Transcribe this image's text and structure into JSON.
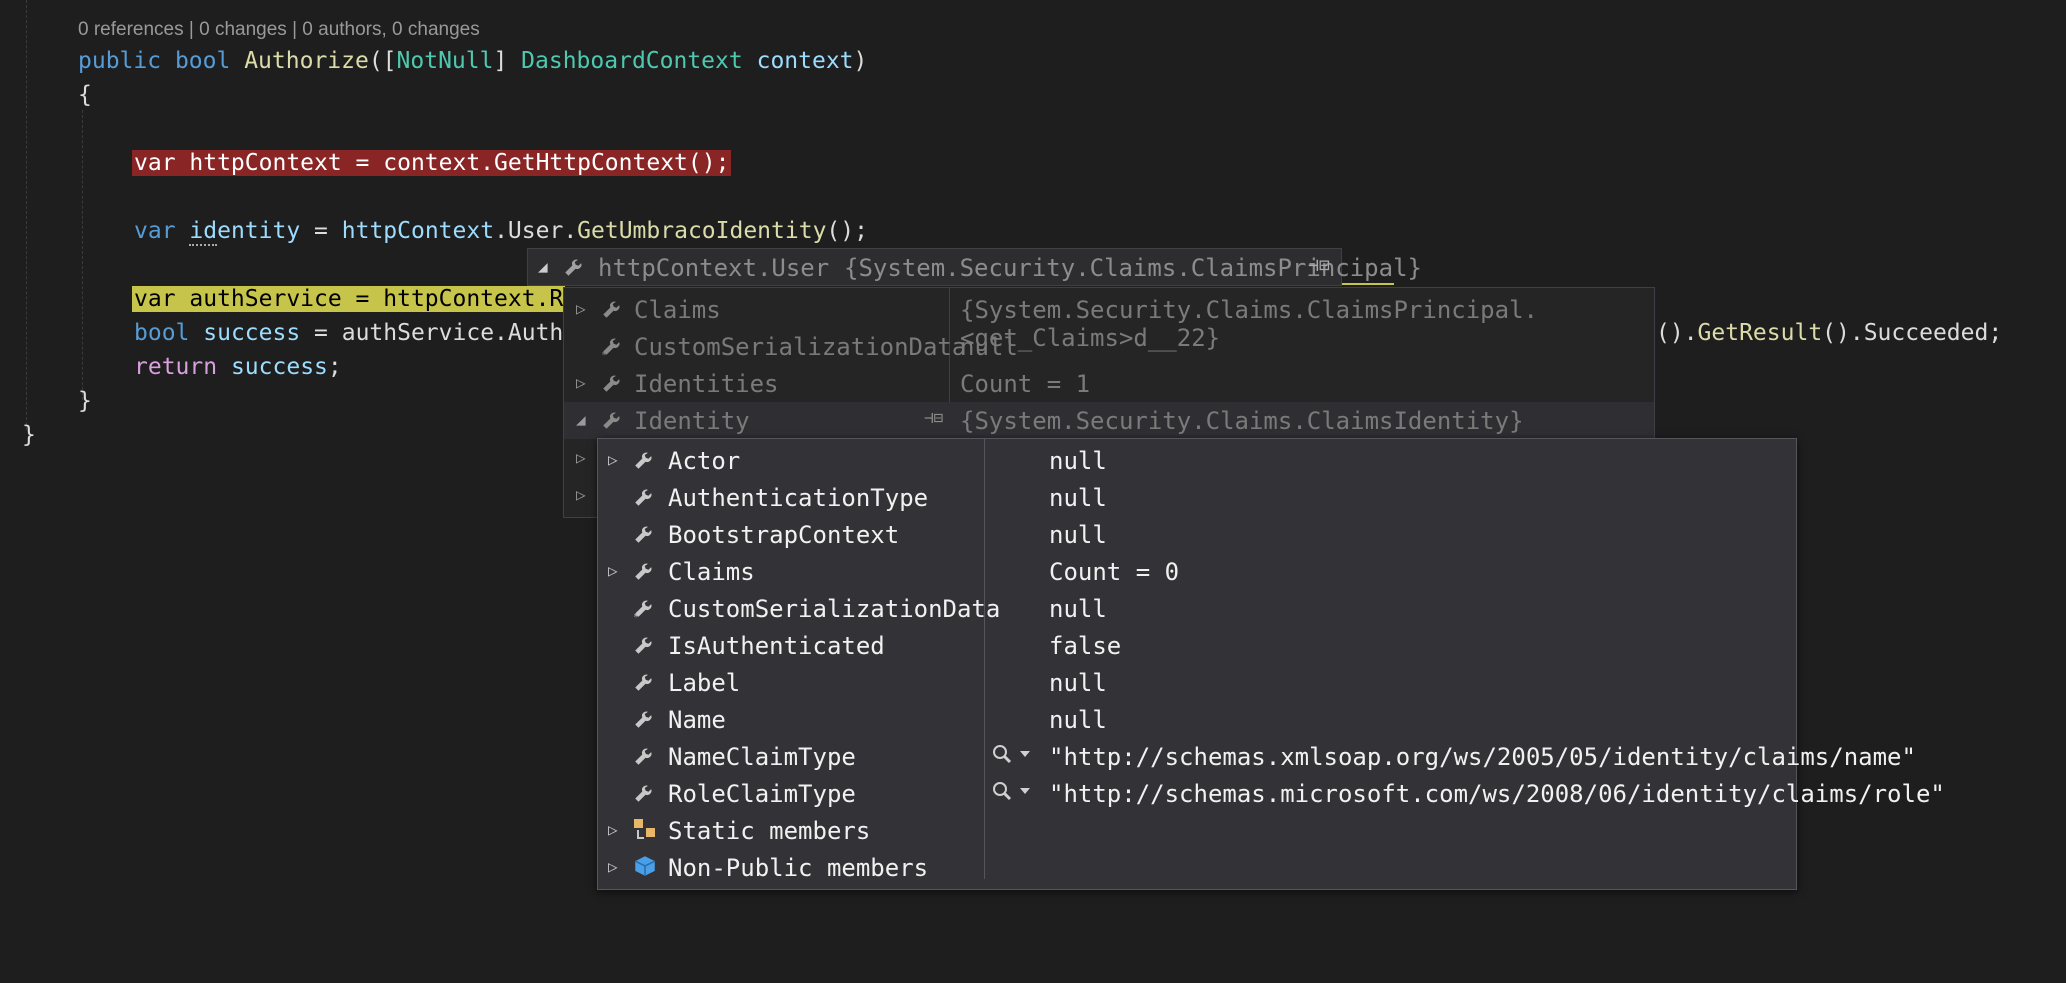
{
  "codelens": "0 references | 0 changes | 0 authors, 0 changes",
  "code": {
    "l1_kw1": "public",
    "l1_kw2": "bool",
    "l1_fn": "Authorize",
    "l1_open": "([",
    "l1_attr": "NotNull",
    "l1_close_attr": "] ",
    "l1_type": "DashboardContext",
    "l1_param": "context",
    "l1_end": ")",
    "l2": "{",
    "l3": "var httpContext = context.GetHttpContext();",
    "l4_kw": "var",
    "l4_a": "id",
    "l4_b": "entity",
    "l4_eq": " = ",
    "l4_var": "httpContext",
    "l4_dot": ".User.",
    "l4_fn": "GetUmbracoIdentity",
    "l4_end": "();",
    "l5": "var authService = httpContext.R",
    "l6_kw": "bool",
    "l6_var": "success",
    "l6_mid": " = authService.Auth",
    "l6_tail_a": "().",
    "l6_tail_fn": "GetResult",
    "l6_tail_b": "().Succeeded;",
    "l7_kw": "return",
    "l7_var": "success",
    "l7_end": ";",
    "l8": "}",
    "l9": "}"
  },
  "datatip": {
    "expression": "httpContext.User",
    "value": "{System.Security.Claims.ClaimsPrincipal}",
    "rows": [
      {
        "name": "Claims",
        "value": "{System.Security.Claims.ClaimsPrincipal.<get_Claims>d__22}",
        "icon": "wrench-icon"
      },
      {
        "name": "CustomSerializationData",
        "value": "null",
        "icon": "wrench-star-icon"
      },
      {
        "name": "Identities",
        "value": "Count = 1",
        "icon": "wrench-icon"
      },
      {
        "name": "Identity",
        "value": "{System.Security.Claims.ClaimsIdentity}",
        "icon": "wrench-icon"
      }
    ]
  },
  "identity": {
    "rows": [
      {
        "name": "Actor",
        "value": "null",
        "expandable": true
      },
      {
        "name": "AuthenticationType",
        "value": "null",
        "expandable": false
      },
      {
        "name": "BootstrapContext",
        "value": "null",
        "expandable": false
      },
      {
        "name": "Claims",
        "value": "Count = 0",
        "expandable": true
      },
      {
        "name": "CustomSerializationData",
        "value": "null",
        "expandable": false
      },
      {
        "name": "IsAuthenticated",
        "value": "false",
        "expandable": false
      },
      {
        "name": "Label",
        "value": "null",
        "expandable": false
      },
      {
        "name": "Name",
        "value": "null",
        "expandable": false
      },
      {
        "name": "NameClaimType",
        "value": "\"http://schemas.xmlsoap.org/ws/2005/05/identity/claims/name\"",
        "expandable": false
      },
      {
        "name": "RoleClaimType",
        "value": "\"http://schemas.microsoft.com/ws/2008/06/identity/claims/role\"",
        "expandable": false
      },
      {
        "name": "Static members",
        "value": "",
        "expandable": true
      },
      {
        "name": "Non-Public members",
        "value": "",
        "expandable": true
      }
    ]
  },
  "colors": {
    "breakpoint": "#8a2525",
    "current_line": "#c7c44b",
    "keyword": "#569cd6"
  }
}
